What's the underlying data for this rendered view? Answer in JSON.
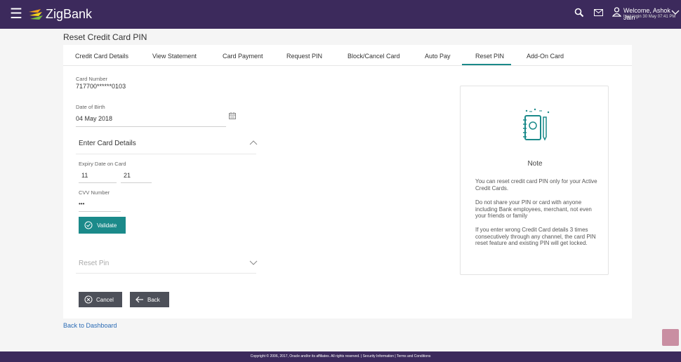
{
  "app": {
    "brand": "ZigBank",
    "welcome": "Welcome, Ashok Jain",
    "last_login": "Last login 30 May 07:41 PM"
  },
  "page": {
    "title": "Reset Credit Card PIN"
  },
  "tabs": [
    {
      "label": "Credit Card Details"
    },
    {
      "label": "View Statement"
    },
    {
      "label": "Card Payment"
    },
    {
      "label": "Request PIN"
    },
    {
      "label": "Block/Cancel Card"
    },
    {
      "label": "Auto Pay"
    },
    {
      "label": "Reset PIN",
      "active": true
    },
    {
      "label": "Add-On Card"
    }
  ],
  "form": {
    "card_number_label": "Card Number",
    "card_number_value": "717700******0103",
    "dob_label": "Date of Birth",
    "dob_value": "04 May 2018",
    "enter_card_details": "Enter Card Details",
    "expiry_label": "Expiry Date on Card",
    "expiry_month": "11",
    "expiry_year": "21",
    "cvv_label": "CVV Number",
    "cvv_value": "•••",
    "validate_label": "Validate",
    "reset_pin_section": "Reset Pin",
    "cancel_label": "Cancel",
    "back_label": "Back"
  },
  "note": {
    "title": "Note",
    "p1": "You can reset credit card PIN only for your Active Credit Cards.",
    "p2": "Do not share your PIN or card with anyone including Bank employees, merchant, not even your friends or family",
    "p3": "If you enter wrong Credit Card details 3 times consecutively through any channel, the card PIN reset feature and existing PIN will get locked."
  },
  "links": {
    "back_to_dashboard": "Back to Dashboard"
  },
  "footer": {
    "text": "Copyright © 2006, 2017, Oracle and/or its affiliates. All rights reserved. | Security Information | Terms and Conditions"
  },
  "colors": {
    "topbar": "#3c2a5c",
    "accent": "#1b8a8a",
    "button_dark": "#4d5059",
    "link": "#2a6bb5"
  }
}
